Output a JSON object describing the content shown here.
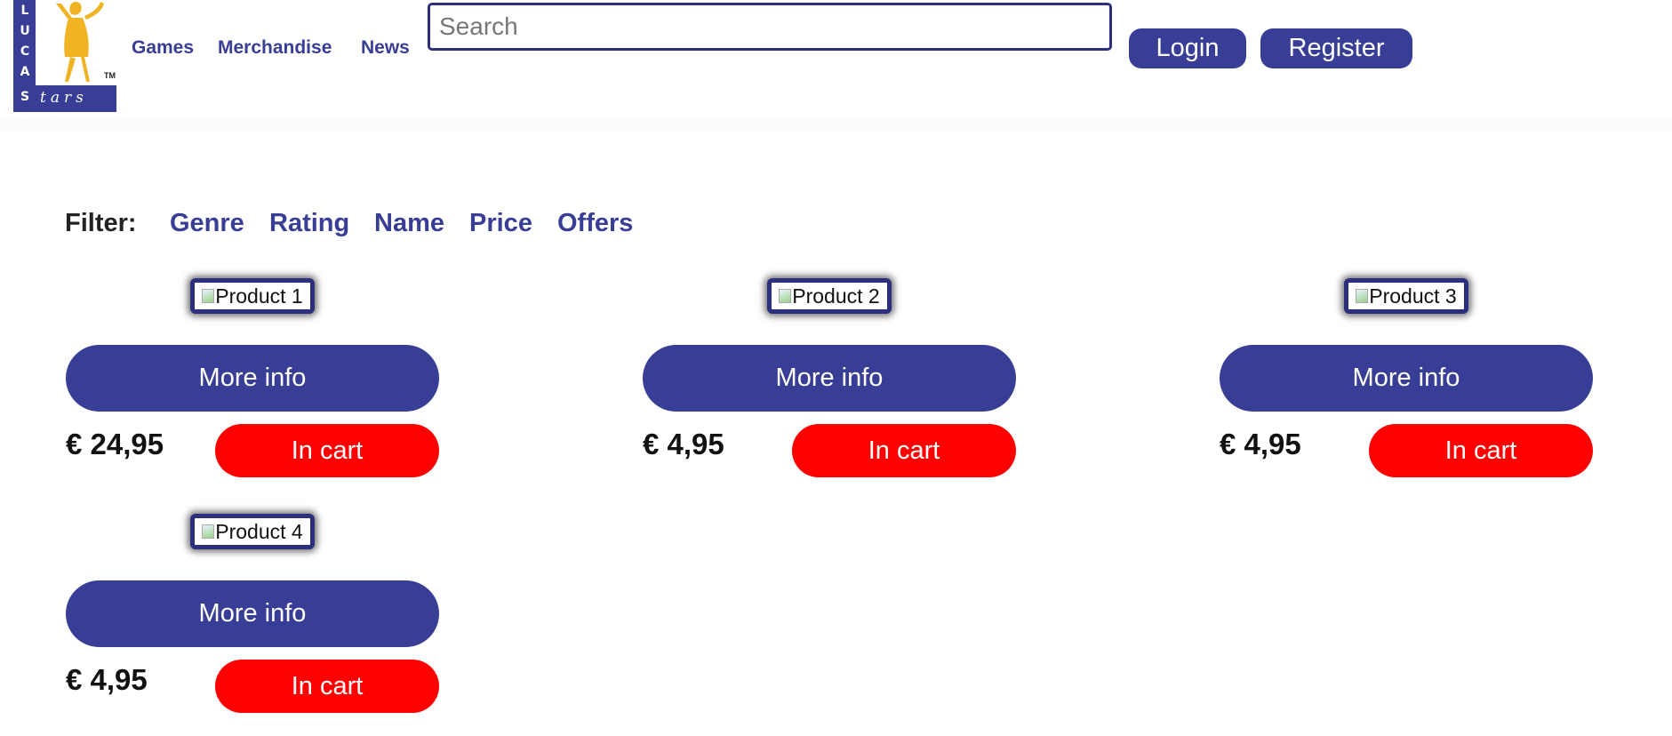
{
  "brand": {
    "logo_letters": [
      "L",
      "U",
      "C",
      "A",
      "S"
    ],
    "logo_wordmark": "tars",
    "logo_tm": "TM"
  },
  "nav": {
    "items": [
      "Games",
      "Merchandise",
      "News"
    ]
  },
  "search": {
    "placeholder": "Search",
    "value": ""
  },
  "auth": {
    "login_label": "Login",
    "register_label": "Register"
  },
  "filter": {
    "label": "Filter:",
    "options": [
      "Genre",
      "Rating",
      "Name",
      "Price",
      "Offers"
    ]
  },
  "products": [
    {
      "image_alt": "Product 1",
      "more_info_label": "More info",
      "price": "€ 24,95",
      "cart_label": "In cart"
    },
    {
      "image_alt": "Product 2",
      "more_info_label": "More info",
      "price": "€ 4,95",
      "cart_label": "In cart"
    },
    {
      "image_alt": "Product 3",
      "more_info_label": "More info",
      "price": "€ 4,95",
      "cart_label": "In cart"
    },
    {
      "image_alt": "Product 4",
      "more_info_label": "More info",
      "price": "€ 4,95",
      "cart_label": "In cart"
    }
  ],
  "colors": {
    "brand_blue": "#383d96",
    "cart_red": "#ff0000",
    "logo_figure": "#f0b323"
  },
  "icons": {
    "logo": "lucas-stars-logo-icon",
    "broken_image": "broken-image-icon"
  }
}
